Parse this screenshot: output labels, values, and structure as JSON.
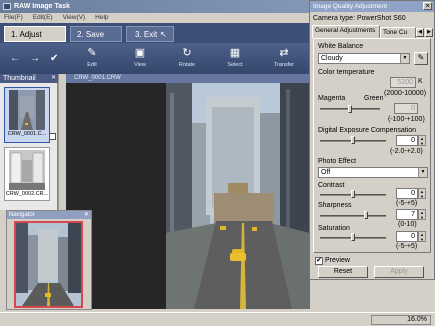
{
  "window": {
    "title": "RAW Image Task"
  },
  "menu": [
    "File(F)",
    "Edit(E)",
    "View(V)",
    "Help"
  ],
  "steps": [
    {
      "label": "1. Adjust Image"
    },
    {
      "label": "2. Save"
    },
    {
      "label": "3. Exit"
    }
  ],
  "toolbar": {
    "back_icon": "arrow-left-icon",
    "forward_icon": "arrow-right-icon",
    "check_icon": "checkmark-icon",
    "buttons": [
      {
        "label": "Edit",
        "icon": "edit-icon"
      },
      {
        "label": "View",
        "icon": "view-icon"
      },
      {
        "label": "Rotate",
        "icon": "rotate-icon"
      },
      {
        "label": "Select",
        "icon": "select-icon"
      },
      {
        "label": "Transfer",
        "icon": "transfer-icon"
      }
    ]
  },
  "thumbnails": {
    "header": "Thumbnail",
    "items": [
      {
        "caption": "CRW_0001.C...",
        "selected": true
      },
      {
        "caption": "CRW_0002.CR...",
        "selected": false
      }
    ]
  },
  "viewer": {
    "filename": "CRW_0001.CRW"
  },
  "navigator": {
    "title": "Navigator"
  },
  "status": {
    "zoom": "16.0%"
  },
  "iqa": {
    "title": "Image Quality Adjustment",
    "camera_type": "Camera type: PowerShot S60",
    "tabs": [
      "General Adjustments",
      "Tone Cu"
    ],
    "white_balance": {
      "label": "White Balance",
      "value": "Cloudy"
    },
    "color_temperature": {
      "label": "Color temperature",
      "value": "5200",
      "unit": "K",
      "range": "(2000-10000)"
    },
    "tint": {
      "left": "Magenta",
      "right": "Green",
      "value": "0",
      "range": "(-100-+100)"
    },
    "exposure": {
      "label": "Digital Exposure Compensation",
      "value": "0",
      "range": "(-2.0-+2.0)"
    },
    "photo_effect": {
      "label": "Photo Effect",
      "value": "Off"
    },
    "contrast": {
      "label": "Contrast",
      "value": "0",
      "range": "(-5-+5)"
    },
    "sharpness": {
      "label": "Sharpness",
      "value": "7",
      "range": "(0-10)"
    },
    "saturation": {
      "label": "Saturation",
      "value": "0",
      "range": "(-5-+5)"
    },
    "preview": {
      "label": "Preview",
      "checked": true
    },
    "reset_label": "Reset",
    "apply_label": "Apply"
  }
}
